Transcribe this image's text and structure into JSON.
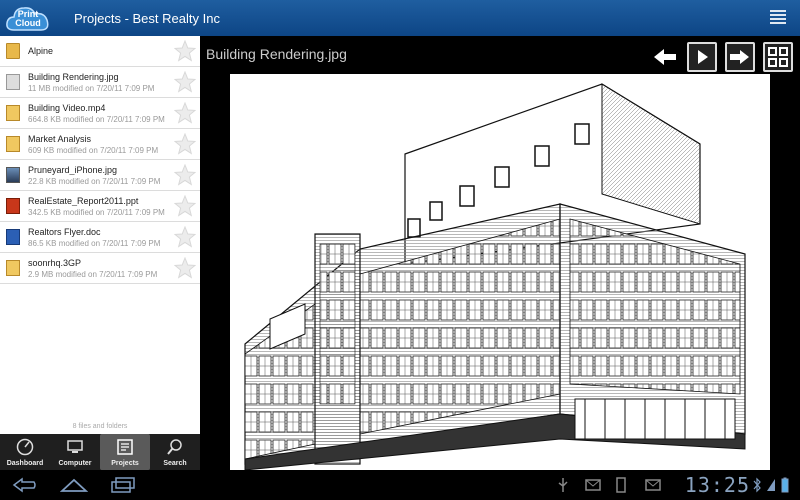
{
  "app": {
    "logo_text_line1": "Print",
    "logo_text_line2": "Cloud",
    "title": "Projects - Best Realty Inc"
  },
  "files": [
    {
      "name": "Alpine",
      "meta": "",
      "type": "folder"
    },
    {
      "name": "Building Rendering.jpg",
      "meta": "11 MB modified on 7/20/11 7:09 PM",
      "type": "render"
    },
    {
      "name": "Building Video.mp4",
      "meta": "664.8 KB modified on 7/20/11 7:09 PM",
      "type": "doc"
    },
    {
      "name": "Market Analysis",
      "meta": "609 KB modified on 7/20/11 7:09 PM",
      "type": "doc"
    },
    {
      "name": "Pruneyard_iPhone.jpg",
      "meta": "22.8 KB modified on 7/20/11 7:09 PM",
      "type": "img"
    },
    {
      "name": "RealEstate_Report2011.ppt",
      "meta": "342.5 KB modified on 7/20/11 7:09 PM",
      "type": "ppt"
    },
    {
      "name": "Realtors Flyer.doc",
      "meta": "86.5 KB modified on 7/20/11 7:09 PM",
      "type": "word"
    },
    {
      "name": "soonrhq.3GP",
      "meta": "2.9 MB modified on 7/20/11 7:09 PM",
      "type": "doc"
    }
  ],
  "footer_count": "8 files and folders",
  "tabs": [
    {
      "label": "Dashboard",
      "active": false
    },
    {
      "label": "Computer",
      "active": false
    },
    {
      "label": "Projects",
      "active": true
    },
    {
      "label": "Search",
      "active": false
    }
  ],
  "viewer": {
    "title": "Building Rendering.jpg"
  },
  "status": {
    "clock": "13:25"
  },
  "colors": {
    "topbar": "#0d4585",
    "accent_blue": "#1f5ea0"
  }
}
